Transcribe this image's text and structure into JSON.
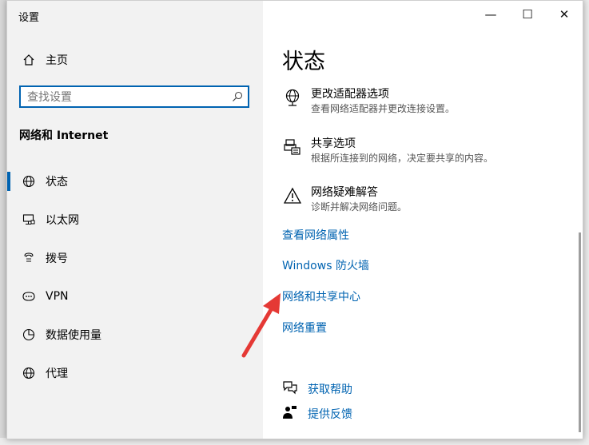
{
  "window": {
    "title": "设置",
    "minimize": "—",
    "maximize": "☐",
    "close": "✕"
  },
  "sidebar": {
    "home_label": "主页",
    "search_placeholder": "查找设置",
    "section_title": "网络和 Internet",
    "items": [
      {
        "label": "状态",
        "icon": "globe-icon",
        "active": true
      },
      {
        "label": "以太网",
        "icon": "ethernet-monitor-icon"
      },
      {
        "label": "拨号",
        "icon": "dialup-icon"
      },
      {
        "label": "VPN",
        "icon": "vpn-icon"
      },
      {
        "label": "数据使用量",
        "icon": "pie-chart-icon"
      },
      {
        "label": "代理",
        "icon": "globe-icon"
      }
    ]
  },
  "main": {
    "page_title": "状态",
    "options": [
      {
        "title": "更改适配器选项",
        "desc": "查看网络适配器并更改连接设置。",
        "icon": "adapter-globe-icon"
      },
      {
        "title": "共享选项",
        "desc": "根据所连接到的网络，决定要共享的内容。",
        "icon": "printer-share-icon"
      },
      {
        "title": "网络疑难解答",
        "desc": "诊断并解决网络问题。",
        "icon": "warning-triangle-icon"
      }
    ],
    "links": [
      "查看网络属性",
      "Windows 防火墙",
      "网络和共享中心",
      "网络重置"
    ],
    "help": [
      {
        "label": "获取帮助",
        "icon": "chat-help-icon"
      },
      {
        "label": "提供反馈",
        "icon": "feedback-person-icon"
      }
    ]
  },
  "colors": {
    "accent": "#0063b1",
    "annotation_arrow": "#e53935"
  }
}
